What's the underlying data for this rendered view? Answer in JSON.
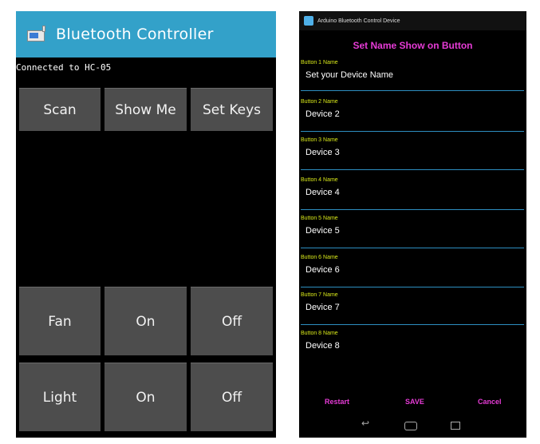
{
  "left_app": {
    "title": "Bluetooth Controller",
    "connection_status": "Connected to HC-05",
    "top_buttons": [
      "Scan",
      "Show Me",
      "Set Keys"
    ],
    "device_rows": [
      {
        "name": "Fan",
        "on_label": "On",
        "off_label": "Off"
      },
      {
        "name": "Light",
        "on_label": "On",
        "off_label": "Off"
      }
    ]
  },
  "right_app": {
    "app_title": "Arduino Bluetooth Control Device",
    "heading": "Set Name Show on Button",
    "fields": [
      {
        "label": "Button 1 Name",
        "value": "Set your Device Name"
      },
      {
        "label": "Button 2 Name",
        "value": "Device 2"
      },
      {
        "label": "Button 3 Name",
        "value": "Device 3"
      },
      {
        "label": "Button 4 Name",
        "value": "Device 4"
      },
      {
        "label": "Button 5 Name",
        "value": "Device 5"
      },
      {
        "label": "Button 6 Name",
        "value": "Device 6"
      },
      {
        "label": "Button 7 Name",
        "value": "Device 7"
      },
      {
        "label": "Button 8 Name",
        "value": "Device 8"
      }
    ],
    "actions": {
      "restart": "Restart",
      "save": "SAVE",
      "cancel": "Cancel"
    },
    "colors": {
      "heading": "#e63bd6",
      "label": "#d8e81a",
      "divider": "#2d8ec0"
    }
  },
  "colors": {
    "title_bar": "#33a1c9",
    "button_bg": "#4d4d4d"
  },
  "icons": [
    "bluetooth-controller-app-icon",
    "arduino-app-icon",
    "back-icon",
    "home-icon",
    "recent-apps-icon"
  ]
}
